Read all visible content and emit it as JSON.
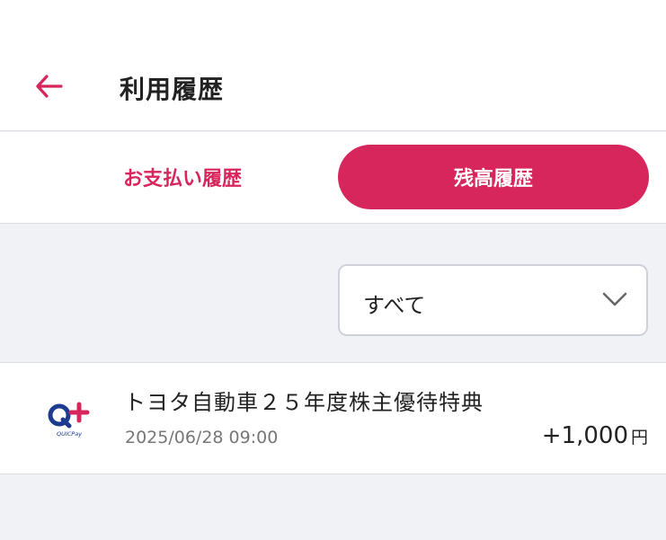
{
  "header": {
    "title": "利用履歴",
    "back_icon": "arrow-left-icon",
    "accent_color": "#d6265c"
  },
  "tabs": [
    {
      "label": "お支払い履歴",
      "active": false
    },
    {
      "label": "残高履歴",
      "active": true
    }
  ],
  "filter": {
    "selected": "すべて",
    "icon": "chevron-down-icon"
  },
  "history": [
    {
      "logo": "quicpay-plus-logo",
      "logo_text": "QUICPay",
      "title": "トヨタ自動車２５年度株主優待特典",
      "datetime": "2025/06/28 09:00",
      "amount": "+1,000",
      "unit": "円"
    }
  ]
}
